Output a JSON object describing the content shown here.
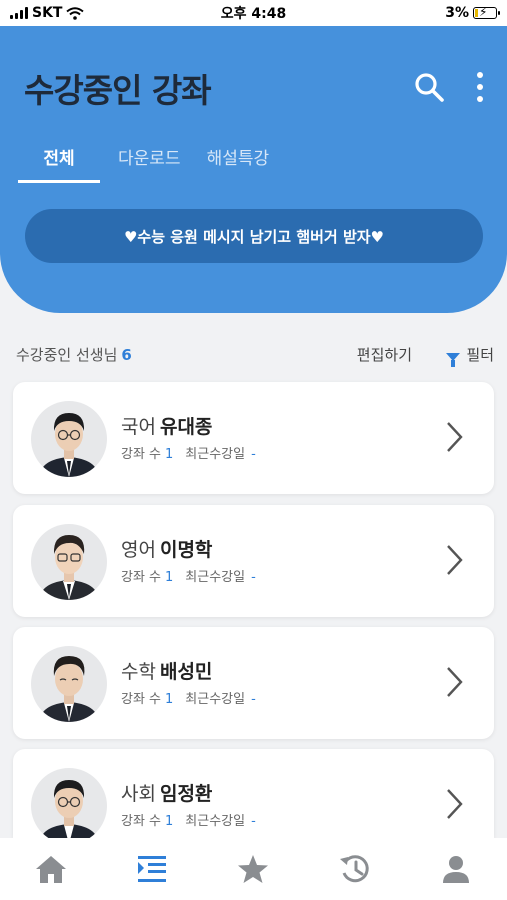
{
  "status_bar": {
    "carrier": "SKT",
    "time": "오후 4:48",
    "battery": "3%"
  },
  "header": {
    "title": "수강중인 강좌",
    "tabs": [
      {
        "label": "전체",
        "active": true
      },
      {
        "label": "다운로드",
        "active": false
      },
      {
        "label": "해설특강",
        "active": false
      }
    ],
    "banner": "♥수능 응원 메시지 남기고 햄버거 받자♥"
  },
  "list_header": {
    "label": "수강중인 선생님",
    "count": "6",
    "edit": "편집하기",
    "filter": "필터"
  },
  "teachers": [
    {
      "subject": "국어",
      "name": "유대종",
      "lecture_label": "강좌 수",
      "lecture_count": "1",
      "recent_label": "최근수강일",
      "recent_value": "-"
    },
    {
      "subject": "영어",
      "name": "이명학",
      "lecture_label": "강좌 수",
      "lecture_count": "1",
      "recent_label": "최근수강일",
      "recent_value": "-"
    },
    {
      "subject": "수학",
      "name": "배성민",
      "lecture_label": "강좌 수",
      "lecture_count": "1",
      "recent_label": "최근수강일",
      "recent_value": "-"
    },
    {
      "subject": "사회",
      "name": "임정환",
      "lecture_label": "강좌 수",
      "lecture_count": "1",
      "recent_label": "최근수강일",
      "recent_value": "-"
    }
  ],
  "bottom_nav": [
    {
      "icon": "home-icon",
      "active": false
    },
    {
      "icon": "lecture-list-icon",
      "active": true
    },
    {
      "icon": "star-icon",
      "active": false
    },
    {
      "icon": "history-icon",
      "active": false
    },
    {
      "icon": "profile-icon",
      "active": false
    }
  ],
  "colors": {
    "primary": "#4691dc",
    "banner": "#2b6cb0",
    "accent": "#2f7fd8",
    "nav_inactive": "#8a8d91"
  }
}
